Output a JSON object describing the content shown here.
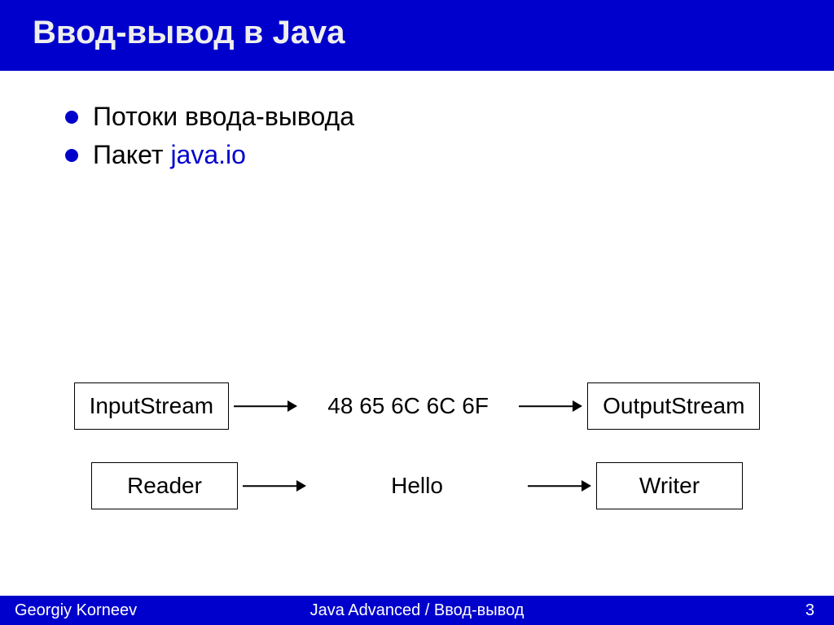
{
  "title": "Ввод-вывод в Java",
  "bullets": {
    "b1": "Потоки ввода-вывода",
    "b2_prefix": "Пакет ",
    "b2_code": "java.io"
  },
  "diagram": {
    "row1": {
      "left": "InputStream",
      "mid": "48 65 6C 6C 6F",
      "right": "OutputStream"
    },
    "row2": {
      "left": "Reader",
      "mid": "Hello",
      "right": "Writer"
    }
  },
  "footer": {
    "left": "Georgiy Korneev",
    "center": "Java Advanced / Ввод-вывод",
    "right": "3"
  }
}
